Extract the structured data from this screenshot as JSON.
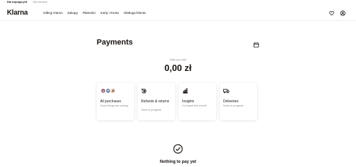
{
  "topbar": {
    "tabs": [
      {
        "label": "Dla kupujących",
        "active": true
      },
      {
        "label": "Dla biznesu",
        "active": false
      }
    ]
  },
  "header": {
    "logo": "Klarna",
    "nav": [
      "Odkryj Klarna",
      "Zakupy",
      "Płatności",
      "Karty i Konta",
      "Obsługa klienta"
    ],
    "icons": [
      "heart-icon",
      "user-icon",
      "calendar-icon"
    ]
  },
  "payments": {
    "title": "Payments",
    "total_label": "Total you owe",
    "total_value": "0,00 zł"
  },
  "cards": [
    {
      "name": "All purchases",
      "sub": "Good things are coming",
      "icon": "avatars"
    },
    {
      "name": "Refunds & returns",
      "sub": "None in progress",
      "icon": "refund-icon"
    },
    {
      "name": "Insights",
      "sub": "0 zł spent this month",
      "icon": "insights-icon"
    },
    {
      "name": "Deliveries",
      "sub": "None in progress",
      "icon": "delivery-icon"
    }
  ],
  "empty_state": {
    "title": "Nothing to pay yet",
    "icon": "check-circle-icon"
  },
  "colors": {
    "text": "#17120f",
    "muted": "#8a8680",
    "avatar_pink": "#f7c7da",
    "avatar_blue": "#c9d7f5",
    "avatar_peach": "#f5d9c6"
  }
}
